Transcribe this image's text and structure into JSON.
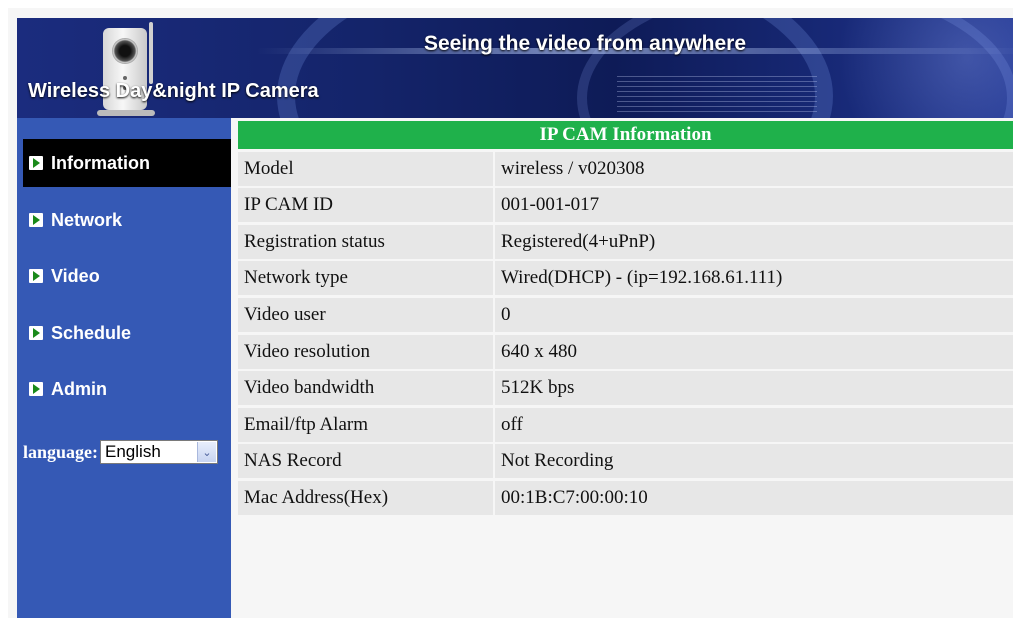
{
  "banner": {
    "title": "Seeing the video from anywhere",
    "subtitle": "Wireless Day&night IP Camera"
  },
  "sidebar": {
    "items": [
      {
        "label": "Information",
        "active": true
      },
      {
        "label": "Network",
        "active": false
      },
      {
        "label": "Video",
        "active": false
      },
      {
        "label": "Schedule",
        "active": false
      },
      {
        "label": "Admin",
        "active": false
      }
    ],
    "language_label": "language:",
    "language_value": "English"
  },
  "info": {
    "header": "IP CAM Information",
    "rows": [
      {
        "key": "Model",
        "value": "wireless / v020308"
      },
      {
        "key": "IP CAM ID",
        "value": "001-001-017"
      },
      {
        "key": "Registration status",
        "value": "Registered(4+uPnP)"
      },
      {
        "key": "Network type",
        "value": "Wired(DHCP) - (ip=192.168.61.111)"
      },
      {
        "key": "Video user",
        "value": "0"
      },
      {
        "key": "Video resolution",
        "value": "640 x 480"
      },
      {
        "key": "Video bandwidth",
        "value": "512K bps"
      },
      {
        "key": "Email/ftp Alarm",
        "value": "off"
      },
      {
        "key": "NAS Record",
        "value": "Not Recording"
      },
      {
        "key": "Mac Address(Hex)",
        "value": "00:1B:C7:00:00:10"
      }
    ]
  },
  "colors": {
    "sidebar": "#3559b5",
    "header_green": "#1fb14b",
    "row_bg": "#e7e7e7",
    "active_nav": "#000000"
  },
  "icons": {
    "nav_arrow": "green-play-arrow-icon",
    "dropdown": "chevron-down-icon",
    "camera": "ip-camera-icon"
  }
}
